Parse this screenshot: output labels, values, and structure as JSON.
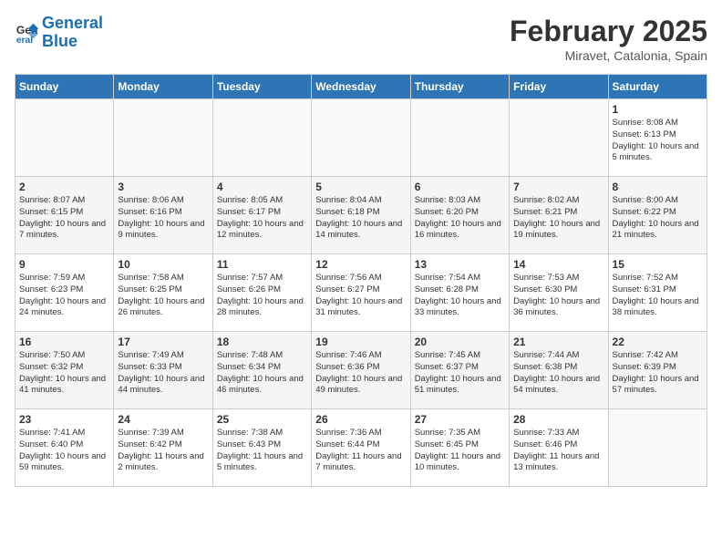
{
  "header": {
    "logo_line1": "General",
    "logo_line2": "Blue",
    "month_year": "February 2025",
    "location": "Miravet, Catalonia, Spain"
  },
  "days_of_week": [
    "Sunday",
    "Monday",
    "Tuesday",
    "Wednesday",
    "Thursday",
    "Friday",
    "Saturday"
  ],
  "weeks": [
    [
      {
        "day": "",
        "text": ""
      },
      {
        "day": "",
        "text": ""
      },
      {
        "day": "",
        "text": ""
      },
      {
        "day": "",
        "text": ""
      },
      {
        "day": "",
        "text": ""
      },
      {
        "day": "",
        "text": ""
      },
      {
        "day": "1",
        "text": "Sunrise: 8:08 AM\nSunset: 6:13 PM\nDaylight: 10 hours and 5 minutes."
      }
    ],
    [
      {
        "day": "2",
        "text": "Sunrise: 8:07 AM\nSunset: 6:15 PM\nDaylight: 10 hours and 7 minutes."
      },
      {
        "day": "3",
        "text": "Sunrise: 8:06 AM\nSunset: 6:16 PM\nDaylight: 10 hours and 9 minutes."
      },
      {
        "day": "4",
        "text": "Sunrise: 8:05 AM\nSunset: 6:17 PM\nDaylight: 10 hours and 12 minutes."
      },
      {
        "day": "5",
        "text": "Sunrise: 8:04 AM\nSunset: 6:18 PM\nDaylight: 10 hours and 14 minutes."
      },
      {
        "day": "6",
        "text": "Sunrise: 8:03 AM\nSunset: 6:20 PM\nDaylight: 10 hours and 16 minutes."
      },
      {
        "day": "7",
        "text": "Sunrise: 8:02 AM\nSunset: 6:21 PM\nDaylight: 10 hours and 19 minutes."
      },
      {
        "day": "8",
        "text": "Sunrise: 8:00 AM\nSunset: 6:22 PM\nDaylight: 10 hours and 21 minutes."
      }
    ],
    [
      {
        "day": "9",
        "text": "Sunrise: 7:59 AM\nSunset: 6:23 PM\nDaylight: 10 hours and 24 minutes."
      },
      {
        "day": "10",
        "text": "Sunrise: 7:58 AM\nSunset: 6:25 PM\nDaylight: 10 hours and 26 minutes."
      },
      {
        "day": "11",
        "text": "Sunrise: 7:57 AM\nSunset: 6:26 PM\nDaylight: 10 hours and 28 minutes."
      },
      {
        "day": "12",
        "text": "Sunrise: 7:56 AM\nSunset: 6:27 PM\nDaylight: 10 hours and 31 minutes."
      },
      {
        "day": "13",
        "text": "Sunrise: 7:54 AM\nSunset: 6:28 PM\nDaylight: 10 hours and 33 minutes."
      },
      {
        "day": "14",
        "text": "Sunrise: 7:53 AM\nSunset: 6:30 PM\nDaylight: 10 hours and 36 minutes."
      },
      {
        "day": "15",
        "text": "Sunrise: 7:52 AM\nSunset: 6:31 PM\nDaylight: 10 hours and 38 minutes."
      }
    ],
    [
      {
        "day": "16",
        "text": "Sunrise: 7:50 AM\nSunset: 6:32 PM\nDaylight: 10 hours and 41 minutes."
      },
      {
        "day": "17",
        "text": "Sunrise: 7:49 AM\nSunset: 6:33 PM\nDaylight: 10 hours and 44 minutes."
      },
      {
        "day": "18",
        "text": "Sunrise: 7:48 AM\nSunset: 6:34 PM\nDaylight: 10 hours and 46 minutes."
      },
      {
        "day": "19",
        "text": "Sunrise: 7:46 AM\nSunset: 6:36 PM\nDaylight: 10 hours and 49 minutes."
      },
      {
        "day": "20",
        "text": "Sunrise: 7:45 AM\nSunset: 6:37 PM\nDaylight: 10 hours and 51 minutes."
      },
      {
        "day": "21",
        "text": "Sunrise: 7:44 AM\nSunset: 6:38 PM\nDaylight: 10 hours and 54 minutes."
      },
      {
        "day": "22",
        "text": "Sunrise: 7:42 AM\nSunset: 6:39 PM\nDaylight: 10 hours and 57 minutes."
      }
    ],
    [
      {
        "day": "23",
        "text": "Sunrise: 7:41 AM\nSunset: 6:40 PM\nDaylight: 10 hours and 59 minutes."
      },
      {
        "day": "24",
        "text": "Sunrise: 7:39 AM\nSunset: 6:42 PM\nDaylight: 11 hours and 2 minutes."
      },
      {
        "day": "25",
        "text": "Sunrise: 7:38 AM\nSunset: 6:43 PM\nDaylight: 11 hours and 5 minutes."
      },
      {
        "day": "26",
        "text": "Sunrise: 7:36 AM\nSunset: 6:44 PM\nDaylight: 11 hours and 7 minutes."
      },
      {
        "day": "27",
        "text": "Sunrise: 7:35 AM\nSunset: 6:45 PM\nDaylight: 11 hours and 10 minutes."
      },
      {
        "day": "28",
        "text": "Sunrise: 7:33 AM\nSunset: 6:46 PM\nDaylight: 11 hours and 13 minutes."
      },
      {
        "day": "",
        "text": ""
      }
    ]
  ]
}
